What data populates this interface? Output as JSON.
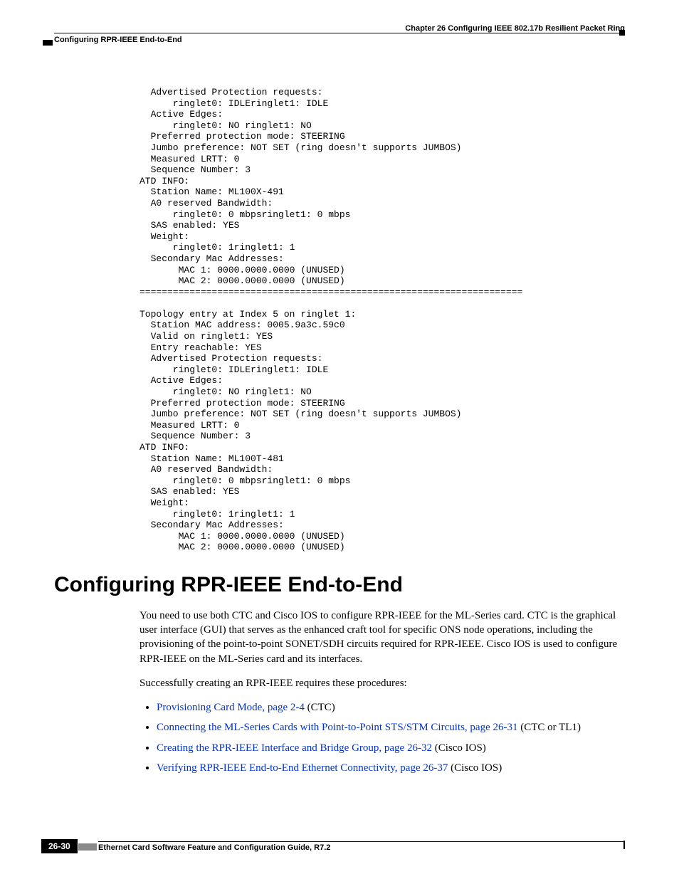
{
  "header": {
    "chapter": "Chapter 26  Configuring IEEE 802.17b Resilient Packet Ring",
    "section": "Configuring RPR-IEEE End-to-End"
  },
  "code": "  Advertised Protection requests: \n      ringlet0: IDLEringlet1: IDLE\n  Active Edges:\n      ringlet0: NO ringlet1: NO \n  Preferred protection mode: STEERING\n  Jumbo preference: NOT SET (ring doesn't supports JUMBOS)\n  Measured LRTT: 0\n  Sequence Number: 3\nATD INFO:\n  Station Name: ML100X-491\n  A0 reserved Bandwidth: \n      ringlet0: 0 mbpsringlet1: 0 mbps\n  SAS enabled: YES\n  Weight: \n      ringlet0: 1ringlet1: 1\n  Secondary Mac Addresses: \n       MAC 1: 0000.0000.0000 (UNUSED)\n       MAC 2: 0000.0000.0000 (UNUSED)\n=====================================================================\n\nTopology entry at Index 5 on ringlet 1: \n  Station MAC address: 0005.9a3c.59c0\n  Valid on ringlet1: YES\n  Entry reachable: YES\n  Advertised Protection requests: \n      ringlet0: IDLEringlet1: IDLE\n  Active Edges:\n      ringlet0: NO ringlet1: NO \n  Preferred protection mode: STEERING\n  Jumbo preference: NOT SET (ring doesn't supports JUMBOS)\n  Measured LRTT: 0\n  Sequence Number: 3\nATD INFO:\n  Station Name: ML100T-481\n  A0 reserved Bandwidth: \n      ringlet0: 0 mbpsringlet1: 0 mbps\n  SAS enabled: YES\n  Weight: \n      ringlet0: 1ringlet1: 1\n  Secondary Mac Addresses: \n       MAC 1: 0000.0000.0000 (UNUSED)\n       MAC 2: 0000.0000.0000 (UNUSED)",
  "heading": "Configuring RPR-IEEE End-to-End",
  "para1": "You need to use both CTC and Cisco IOS to configure RPR-IEEE for the ML-Series card. CTC is the graphical user interface (GUI) that serves as the enhanced craft tool for specific ONS node operations, including the provisioning of the point-to-point SONET/SDH circuits required for RPR-IEEE. Cisco IOS is used to configure RPR-IEEE on the ML-Series card and its interfaces.",
  "para2": "Successfully creating an RPR-IEEE requires these procedures:",
  "bullets": [
    {
      "link": "Provisioning Card Mode, page 2-4",
      "suffix": " (CTC)"
    },
    {
      "link": "Connecting the ML-Series Cards with Point-to-Point STS/STM Circuits, page 26-31",
      "suffix": " (CTC or TL1)"
    },
    {
      "link": "Creating the RPR-IEEE Interface and Bridge Group, page 26-32",
      "suffix": " (Cisco IOS)"
    },
    {
      "link": "Verifying RPR-IEEE End-to-End Ethernet Connectivity, page 26-37",
      "suffix": " (Cisco IOS)"
    }
  ],
  "footer": {
    "title": "Ethernet Card Software Feature and Configuration Guide, R7.2",
    "pagenum": "26-30"
  }
}
